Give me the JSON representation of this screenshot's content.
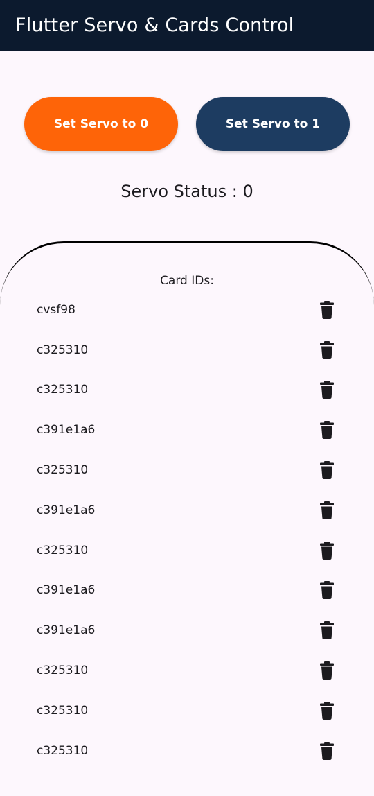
{
  "app_bar": {
    "title": "Flutter Servo & Cards Control"
  },
  "buttons": {
    "servo_zero_label": "Set Servo to 0",
    "servo_one_label": "Set Servo to 1"
  },
  "status": {
    "text": "Servo Status : 0"
  },
  "cards": {
    "heading": "Card IDs:",
    "items": [
      {
        "id": "cvsf98",
        "icon": "delete-icon"
      },
      {
        "id": "c325310",
        "icon": "delete-icon"
      },
      {
        "id": "c325310",
        "icon": "delete-icon"
      },
      {
        "id": "c391e1a6",
        "icon": "delete-icon"
      },
      {
        "id": "c325310",
        "icon": "delete-icon"
      },
      {
        "id": "c391e1a6",
        "icon": "delete-icon"
      },
      {
        "id": "c325310",
        "icon": "delete-icon"
      },
      {
        "id": "c391e1a6",
        "icon": "delete-icon"
      },
      {
        "id": "c391e1a6",
        "icon": "delete-icon"
      },
      {
        "id": "c325310",
        "icon": "delete-icon"
      },
      {
        "id": "c325310",
        "icon": "delete-icon"
      },
      {
        "id": "c325310",
        "icon": "delete-icon"
      }
    ]
  },
  "colors": {
    "app_bar": "#0c1a2e",
    "background": "#fdf7fd",
    "servo_zero_button": "#fe6408",
    "servo_one_button": "#1d3c61",
    "text": "#1c1b1f"
  }
}
